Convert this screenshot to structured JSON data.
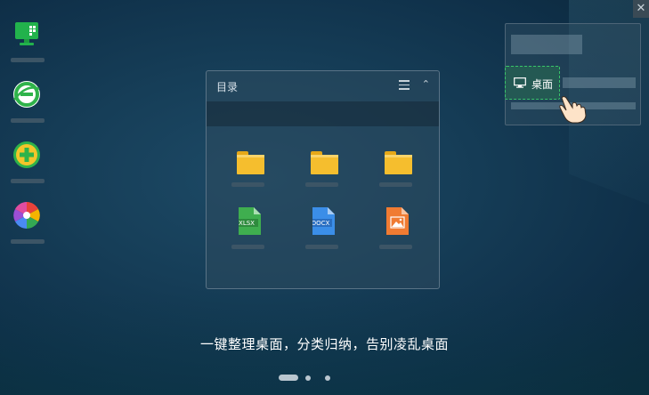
{
  "window": {
    "close_glyph": "✕"
  },
  "sidebar_apps": [
    {
      "icon": "green-monitor-app-icon"
    },
    {
      "icon": "green-browser-app-icon"
    },
    {
      "icon": "yellow-plus-app-icon"
    },
    {
      "icon": "colorful-pinwheel-app-icon"
    }
  ],
  "panel": {
    "title": "目录",
    "menu_icon": "menu-icon",
    "collapse_glyph": "⌃",
    "items": [
      {
        "type": "folder"
      },
      {
        "type": "folder"
      },
      {
        "type": "folder"
      },
      {
        "type": "file",
        "label": "XLSX",
        "color": "#3fae4f"
      },
      {
        "type": "file",
        "label": "DOCX",
        "color": "#3b8ee8"
      },
      {
        "type": "file",
        "label": "",
        "color": "#f07b32"
      }
    ]
  },
  "desktop_chip": {
    "label": "桌面",
    "icon": "monitor-icon"
  },
  "slogan": "一键整理桌面，分类归纳，告别凌乱桌面",
  "pager": {
    "pages": 3,
    "current": 1
  },
  "colors": {
    "accent_green": "#39c56a",
    "folder_yellow": "#f5be2e"
  }
}
